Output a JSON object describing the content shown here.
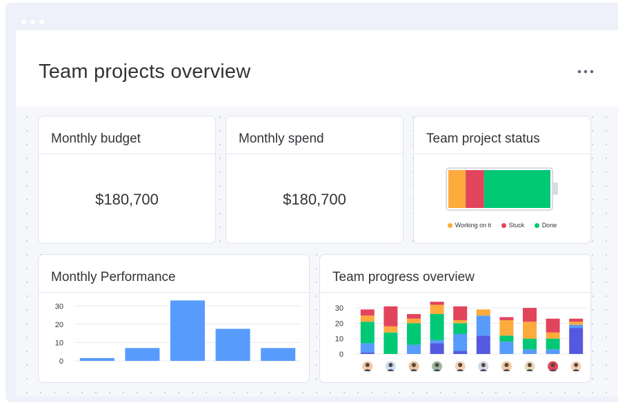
{
  "header": {
    "title": "Team projects overview",
    "more_icon": "more-horizontal-icon"
  },
  "cards": {
    "budget": {
      "title": "Monthly budget",
      "value": "$180,700"
    },
    "spend": {
      "title": "Monthly spend",
      "value": "$180,700"
    },
    "status": {
      "title": "Team project status",
      "legend": [
        {
          "label": "Working on it",
          "color": "#fdab3d"
        },
        {
          "label": "Stuck",
          "color": "#e2445c"
        },
        {
          "label": "Done",
          "color": "#00c875"
        }
      ]
    },
    "performance": {
      "title": "Monthly Performance"
    },
    "progress": {
      "title": "Team progress overview"
    }
  },
  "chart_data": [
    {
      "type": "bar",
      "title": "Team project status",
      "orientation": "horizontal-stacked",
      "categories": [
        "Working on it",
        "Stuck",
        "Done"
      ],
      "values": [
        17,
        18,
        65
      ],
      "colors": [
        "#fdab3d",
        "#e2445c",
        "#00c875"
      ]
    },
    {
      "type": "bar",
      "title": "Monthly Performance",
      "ylim": [
        0,
        35
      ],
      "yticks": [
        0,
        10,
        20,
        30
      ],
      "values": [
        1.5,
        7,
        33,
        17.5,
        7
      ],
      "color": "#579bfc",
      "grid": true
    },
    {
      "type": "bar",
      "title": "Team progress overview",
      "stacked": true,
      "ylim": [
        0,
        35
      ],
      "yticks": [
        0,
        10,
        20,
        30
      ],
      "series_colors": [
        "#5559df",
        "#579bfc",
        "#00c875",
        "#fdab3d",
        "#e2445c"
      ],
      "stacks": [
        [
          1,
          6,
          14,
          4,
          4
        ],
        [
          0,
          0,
          14,
          4,
          13
        ],
        [
          0,
          6,
          14,
          3,
          3
        ],
        [
          7,
          2,
          17,
          6,
          2
        ],
        [
          2,
          11,
          7,
          2,
          9
        ],
        [
          12,
          13,
          0,
          4,
          0
        ],
        [
          0,
          8,
          4,
          10,
          2
        ],
        [
          0,
          3,
          7,
          11,
          9
        ],
        [
          0,
          3,
          7,
          4,
          9
        ],
        [
          17,
          2,
          0,
          2,
          2
        ]
      ],
      "avatars": [
        "#f4c7a8",
        "#c9ddf3",
        "#e8c1a0",
        "#9db7a1",
        "#f5d0b5",
        "#cfd8e6",
        "#f1c9a5",
        "#e9d8b8",
        "#e2445c",
        "#f3d2b9"
      ]
    }
  ]
}
